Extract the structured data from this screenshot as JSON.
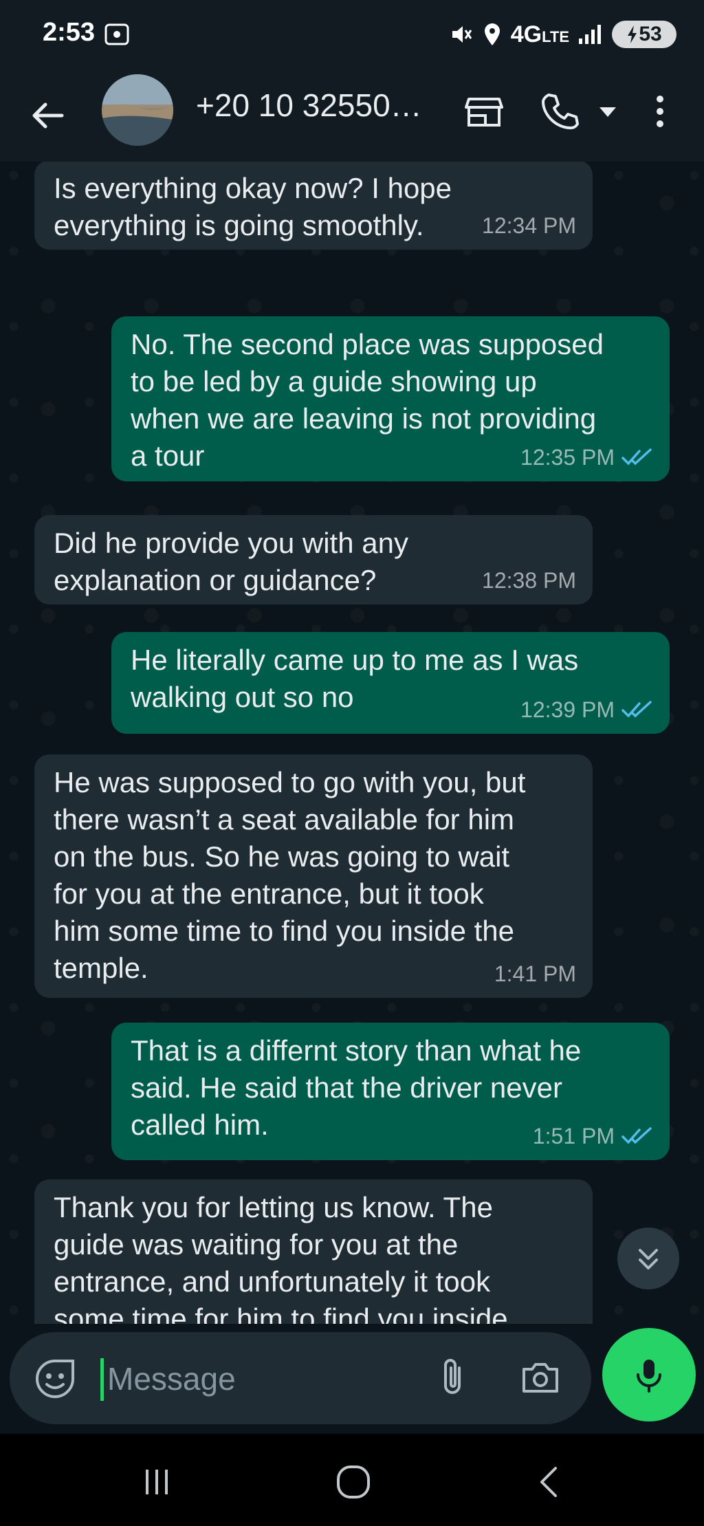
{
  "status_bar": {
    "time": "2:53",
    "network": "4G",
    "network_sub": "LTE",
    "battery": "53"
  },
  "header": {
    "contact": "+20 10 32550…"
  },
  "messages": [
    {
      "dir": "in",
      "text": "Is everything okay now? I hope\neverything is going smoothly.",
      "time": "12:34 PM"
    },
    {
      "dir": "out",
      "text": "No. The second place was supposed\nto be led by a guide showing up\nwhen we are leaving is not providing\na tour",
      "time": "12:35 PM",
      "read": true
    },
    {
      "dir": "in",
      "text": "Did he provide you with any\nexplanation or guidance?",
      "time": "12:38 PM"
    },
    {
      "dir": "out",
      "text": "He literally came up to me as I was\nwalking out so no",
      "time": "12:39 PM",
      "read": true
    },
    {
      "dir": "in",
      "text": "He was supposed to go with you, but\nthere wasn’t a seat available for him\non the bus. So he was going to wait\nfor you at the entrance, but it took\nhim some time to find you inside the\ntemple.",
      "time": "1:41 PM"
    },
    {
      "dir": "out",
      "text": "That is a differnt story than what he\nsaid. He said that the driver never\ncalled him.",
      "time": "1:51 PM",
      "read": true
    },
    {
      "dir": "in",
      "text": "Thank you for letting us know. The\nguide was waiting for you at the\nentrance, and unfortunately it took\nsome time for him to find you inside",
      "time": ""
    }
  ],
  "composer": {
    "placeholder": "Message"
  },
  "colors": {
    "background": "#0b141a",
    "incoming_bubble": "#202c33",
    "outgoing_bubble": "#005c4b",
    "accent_green": "#25d366",
    "read_ticks": "#53bdeb"
  },
  "icons": {
    "back": "arrow-left-icon",
    "business": "storefront-icon",
    "call": "phone-icon",
    "call_menu": "caret-down-icon",
    "more": "more-vertical-icon",
    "emoji": "sticker-icon",
    "attach": "paperclip-icon",
    "camera": "camera-icon",
    "mic": "microphone-icon",
    "scroll": "double-chevron-down-icon"
  }
}
